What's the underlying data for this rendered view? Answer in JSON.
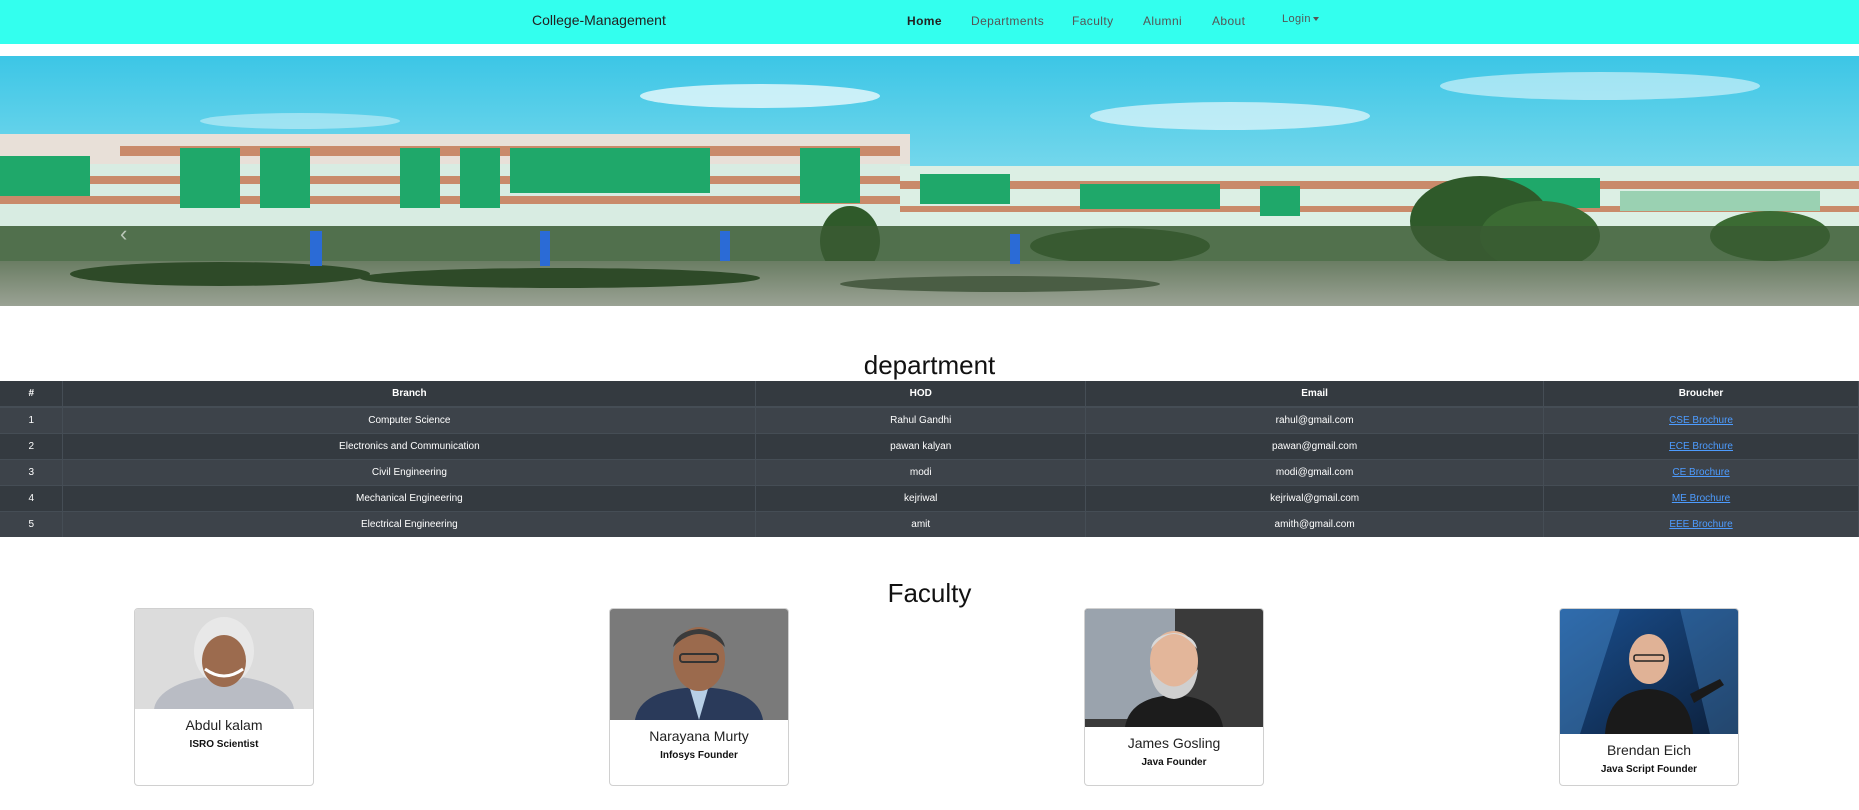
{
  "navbar": {
    "brand": "College-Management",
    "links": [
      {
        "label": "Home",
        "active": true
      },
      {
        "label": "Departments"
      },
      {
        "label": "Faculty"
      },
      {
        "label": "Alumni"
      },
      {
        "label": "About"
      }
    ],
    "login_label": "Login",
    "background": "#33ffee"
  },
  "hero": {
    "prev_glyph": "‹",
    "indicator_count": 3,
    "active_indicator": 1
  },
  "department": {
    "title": "department",
    "columns": [
      "#",
      "Branch",
      "HOD",
      "Email",
      "Broucher"
    ],
    "rows": [
      {
        "num": "1",
        "branch": "Computer Science",
        "hod": "Rahul Gandhi",
        "email": "rahul@gmail.com",
        "brochure": "CSE Brochure"
      },
      {
        "num": "2",
        "branch": "Electronics and Communication",
        "hod": "pawan kalyan",
        "email": "pawan@gmail.com",
        "brochure": "ECE Brochure"
      },
      {
        "num": "3",
        "branch": "Civil Engineering",
        "hod": "modi",
        "email": "modi@gmail.com",
        "brochure": "CE Brochure"
      },
      {
        "num": "4",
        "branch": "Mechanical Engineering",
        "hod": "kejriwal",
        "email": "kejriwal@gmail.com",
        "brochure": "ME Brochure"
      },
      {
        "num": "5",
        "branch": "Electrical Engineering",
        "hod": "amit",
        "email": "amith@gmail.com",
        "brochure": "EEE Brochure"
      }
    ],
    "link_color": "#4d9cff"
  },
  "faculty": {
    "title": "Faculty",
    "cards": [
      {
        "name": "Abdul kalam",
        "role": "ISRO Scientist"
      },
      {
        "name": "Narayana Murty",
        "role": "Infosys Founder"
      },
      {
        "name": "James Gosling",
        "role": "Java Founder"
      },
      {
        "name": "Brendan Eich",
        "role": "Java Script Founder"
      }
    ]
  }
}
